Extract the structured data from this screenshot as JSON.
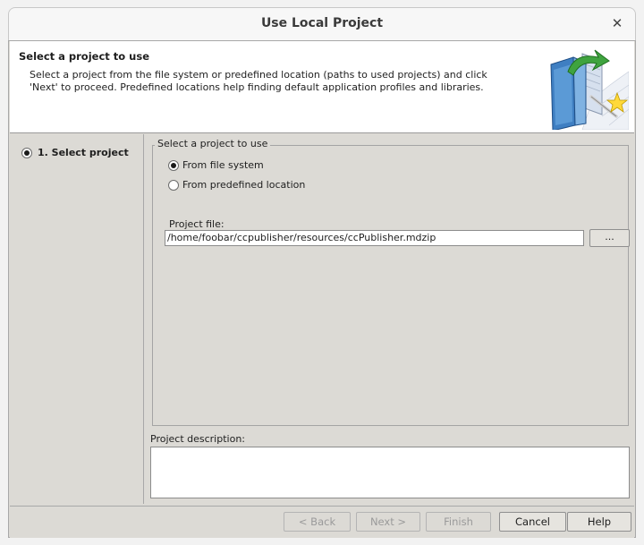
{
  "window": {
    "title": "Use Local Project"
  },
  "header": {
    "title": "Select a project to use",
    "description_line1": "Select a project from the file system or predefined location (paths to used projects) and click",
    "description_line2": "'Next' to proceed. Predefined locations help finding default application profiles and libraries."
  },
  "steps": [
    {
      "label": "1. Select project",
      "selected": true
    }
  ],
  "group": {
    "legend": "Select a project to use",
    "options": [
      {
        "label": "From file system",
        "selected": true
      },
      {
        "label": "From predefined location",
        "selected": false
      }
    ]
  },
  "project_file": {
    "label": "Project file:",
    "value": "/home/foobar/ccpublisher/resources/ccPublisher.mdzip",
    "browse_label": "..."
  },
  "project_description": {
    "label": "Project description:",
    "value": ""
  },
  "buttons": {
    "back": "< Back",
    "next": "Next >",
    "finish": "Finish",
    "cancel": "Cancel",
    "help": "Help"
  },
  "icons": {
    "close": "close-icon",
    "header_art": "project-wizard-icon"
  }
}
